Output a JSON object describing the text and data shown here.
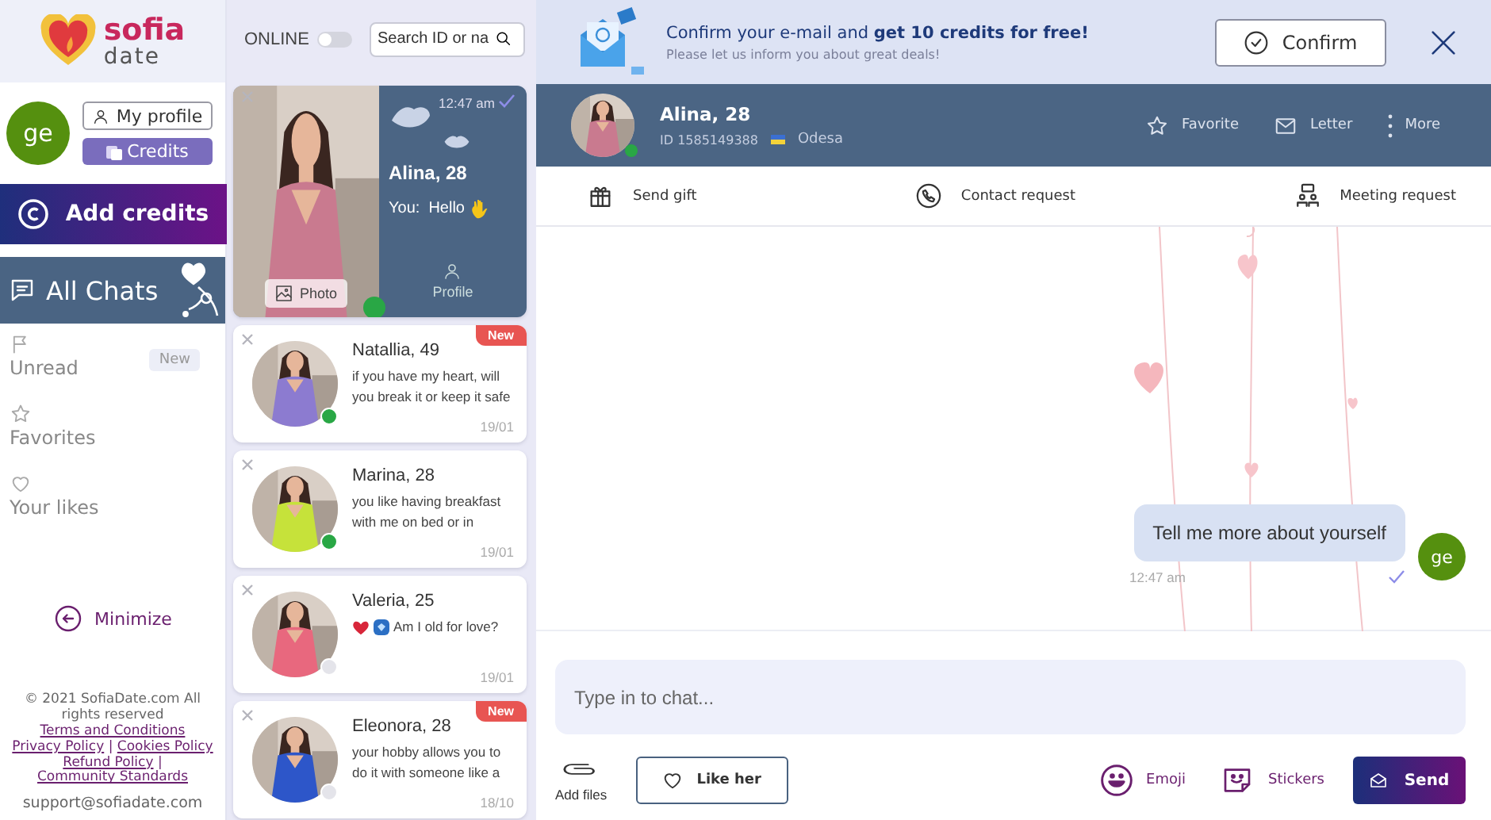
{
  "logo": {
    "name": "sofia",
    "tagline": "date"
  },
  "profile": {
    "avatar": "ge",
    "my_profile": "My profile",
    "credits": "Credits"
  },
  "add_credits": "Add credits",
  "chats_header": "All Chats",
  "menu": [
    {
      "label": "Unread",
      "kind": "flag",
      "badge": "New"
    },
    {
      "label": "Favorites",
      "kind": "star"
    },
    {
      "label": "Your likes",
      "kind": "heart"
    }
  ],
  "minimize": "Minimize",
  "footer": {
    "copyright": "© 2021 SofiaDate.com All rights reserved",
    "link_lines": [
      [
        {
          "text": "Terms and Conditions",
          "kind": "link"
        }
      ],
      [
        {
          "text": "Privacy Policy",
          "kind": "link"
        },
        {
          "text": "|",
          "kind": "separator"
        },
        {
          "text": "Cookies Policy",
          "kind": "link"
        }
      ],
      [
        {
          "text": "Refund Policy",
          "kind": "link"
        },
        {
          "text": "|",
          "kind": "separator"
        }
      ],
      [
        {
          "text": "Community Standards",
          "kind": "link"
        }
      ]
    ],
    "email": "support@sofiadate.com"
  },
  "online_filter": {
    "label": "ONLINE",
    "on": false
  },
  "search": {
    "placeholder": "Search ID or na"
  },
  "chats": [
    {
      "name": "Alina, 28",
      "selected": true,
      "online": true,
      "read": true,
      "time": "12:47 am",
      "sender": "You:",
      "preview": "Hello",
      "photo_button": "Photo",
      "profile_button": "Profile"
    },
    {
      "name": "Natallia, 49",
      "selected": false,
      "online": true,
      "new": "New",
      "preview": "if you have my heart, will you break it or keep it safe",
      "date": "19/01"
    },
    {
      "name": "Marina, 28",
      "selected": false,
      "online": true,
      "preview": "you like having breakfast with me on bed or in",
      "date": "19/01"
    },
    {
      "name": "Valeria, 25",
      "selected": false,
      "online": false,
      "preview_icons": [
        {
          "kind": "heart"
        },
        {
          "kind": "gem"
        }
      ],
      "preview": "Am I old for love?",
      "date": "19/01"
    },
    {
      "name": "Eleonora, 28",
      "selected": false,
      "online": false,
      "new": "New",
      "preview": "your hobby allows you to do it with someone like a",
      "date": "18/10"
    }
  ],
  "banner": {
    "title": "Confirm your e-mail and **get 10 credits for free!**",
    "subtitle": "Please let us inform you about great deals!",
    "confirm": "Confirm"
  },
  "contact": {
    "name": "Alina, 28",
    "id": "ID 1585149388",
    "city": "Odesa",
    "online": true,
    "actions": [
      {
        "label": "Favorite",
        "kind": "star"
      },
      {
        "label": "Letter",
        "kind": "mail"
      },
      {
        "label": "More",
        "kind": "dots"
      }
    ]
  },
  "requests": [
    {
      "label": "Send gift",
      "kind": "gift"
    },
    {
      "label": "Contact request",
      "kind": "phone"
    },
    {
      "label": "Meeting request",
      "kind": "meeting"
    }
  ],
  "messages": [
    {
      "text": "Tell me more about yourself",
      "time": "12:47 am",
      "avatar": "ge",
      "read": true
    }
  ],
  "composer": {
    "placeholder": "Type in to chat...",
    "add_files": "Add files",
    "like": "Like her",
    "emoji": "Emoji",
    "stickers": "Stickers",
    "send": "Send"
  }
}
